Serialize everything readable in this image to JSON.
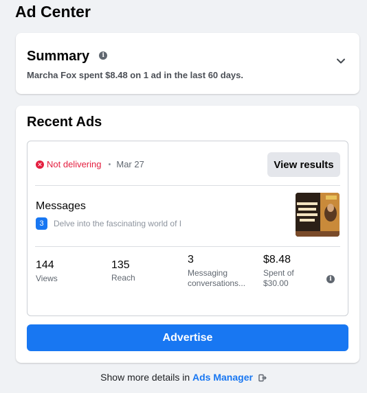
{
  "page": {
    "title": "Ad Center"
  },
  "summary": {
    "title": "Summary",
    "description": "Marcha Fox spent $8.48 on 1 ad in the last 60 days."
  },
  "recent_ads": {
    "title": "Recent Ads",
    "ad": {
      "status": "Not delivering",
      "date": "Mar 27",
      "view_results_label": "View results",
      "type": "Messages",
      "badge_count": "3",
      "description": "Delve into the fascinating world of I",
      "stats": [
        {
          "value": "144",
          "label": "Views"
        },
        {
          "value": "135",
          "label": "Reach"
        },
        {
          "value": "3",
          "label": "Messaging conversations..."
        },
        {
          "value": "$8.48",
          "label": "Spent of $30.00"
        }
      ]
    },
    "advertise_label": "Advertise"
  },
  "footer": {
    "text": "Show more details in",
    "link": "Ads Manager"
  },
  "colors": {
    "accent": "#1877f2",
    "error": "#e41e3f",
    "background": "#f0f2f5"
  }
}
